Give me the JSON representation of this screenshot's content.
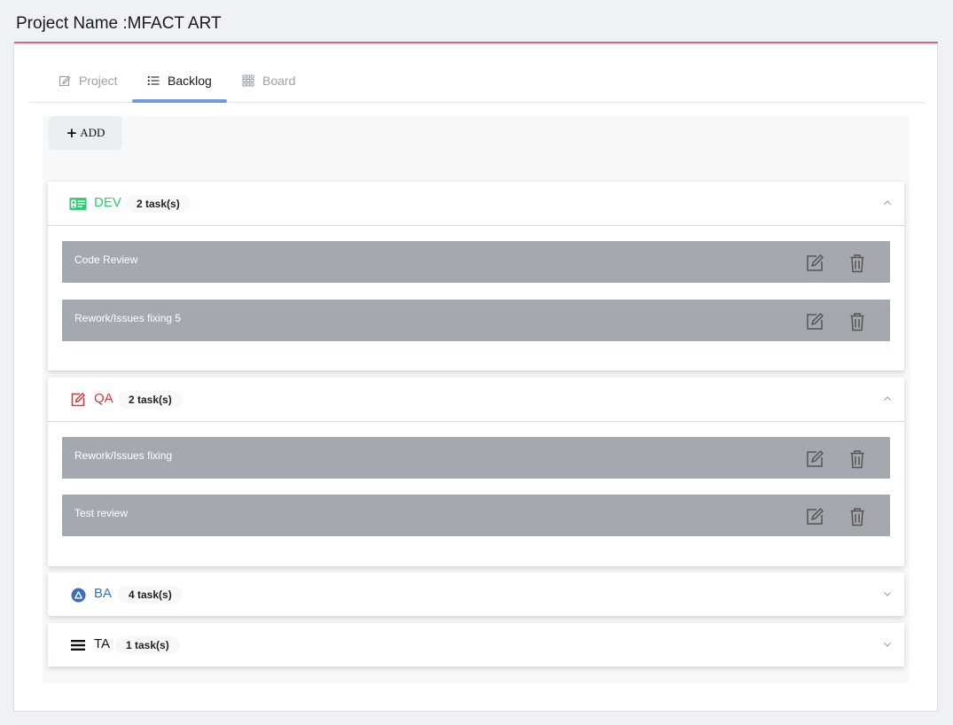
{
  "header": {
    "title": "Project Name :MFACT ART"
  },
  "tabs": [
    {
      "label": "Project",
      "icon": "edit-note-icon",
      "active": false
    },
    {
      "label": "Backlog",
      "icon": "list-icon",
      "active": true
    },
    {
      "label": "Board",
      "icon": "grid-icon",
      "active": false
    }
  ],
  "toolbar": {
    "add_label": "ADD"
  },
  "groups": [
    {
      "name": "DEV",
      "count": "2 task(s)",
      "color": "#2ecc71",
      "icon": "id-card-icon",
      "expanded": true,
      "tasks": [
        {
          "title": "Code Review"
        },
        {
          "title": "Rework/Issues fixing 5"
        }
      ]
    },
    {
      "name": "QA",
      "count": "2 task(s)",
      "color": "#d63a3a",
      "icon": "edit-square-icon",
      "expanded": true,
      "tasks": [
        {
          "title": "Rework/Issues fixing"
        },
        {
          "title": "Test review"
        }
      ]
    },
    {
      "name": "BA",
      "count": "4 task(s)",
      "color": "#3c6fb8",
      "icon": "circle-a-icon",
      "expanded": false
    },
    {
      "name": "TA",
      "count": "1 task(s)",
      "color": "#111111",
      "icon": "bars-icon",
      "expanded": false
    }
  ],
  "colors": {
    "accent_line": "#e8637a",
    "tab_underline": "#6f9be3",
    "task_bg": "#a4a9b0"
  }
}
